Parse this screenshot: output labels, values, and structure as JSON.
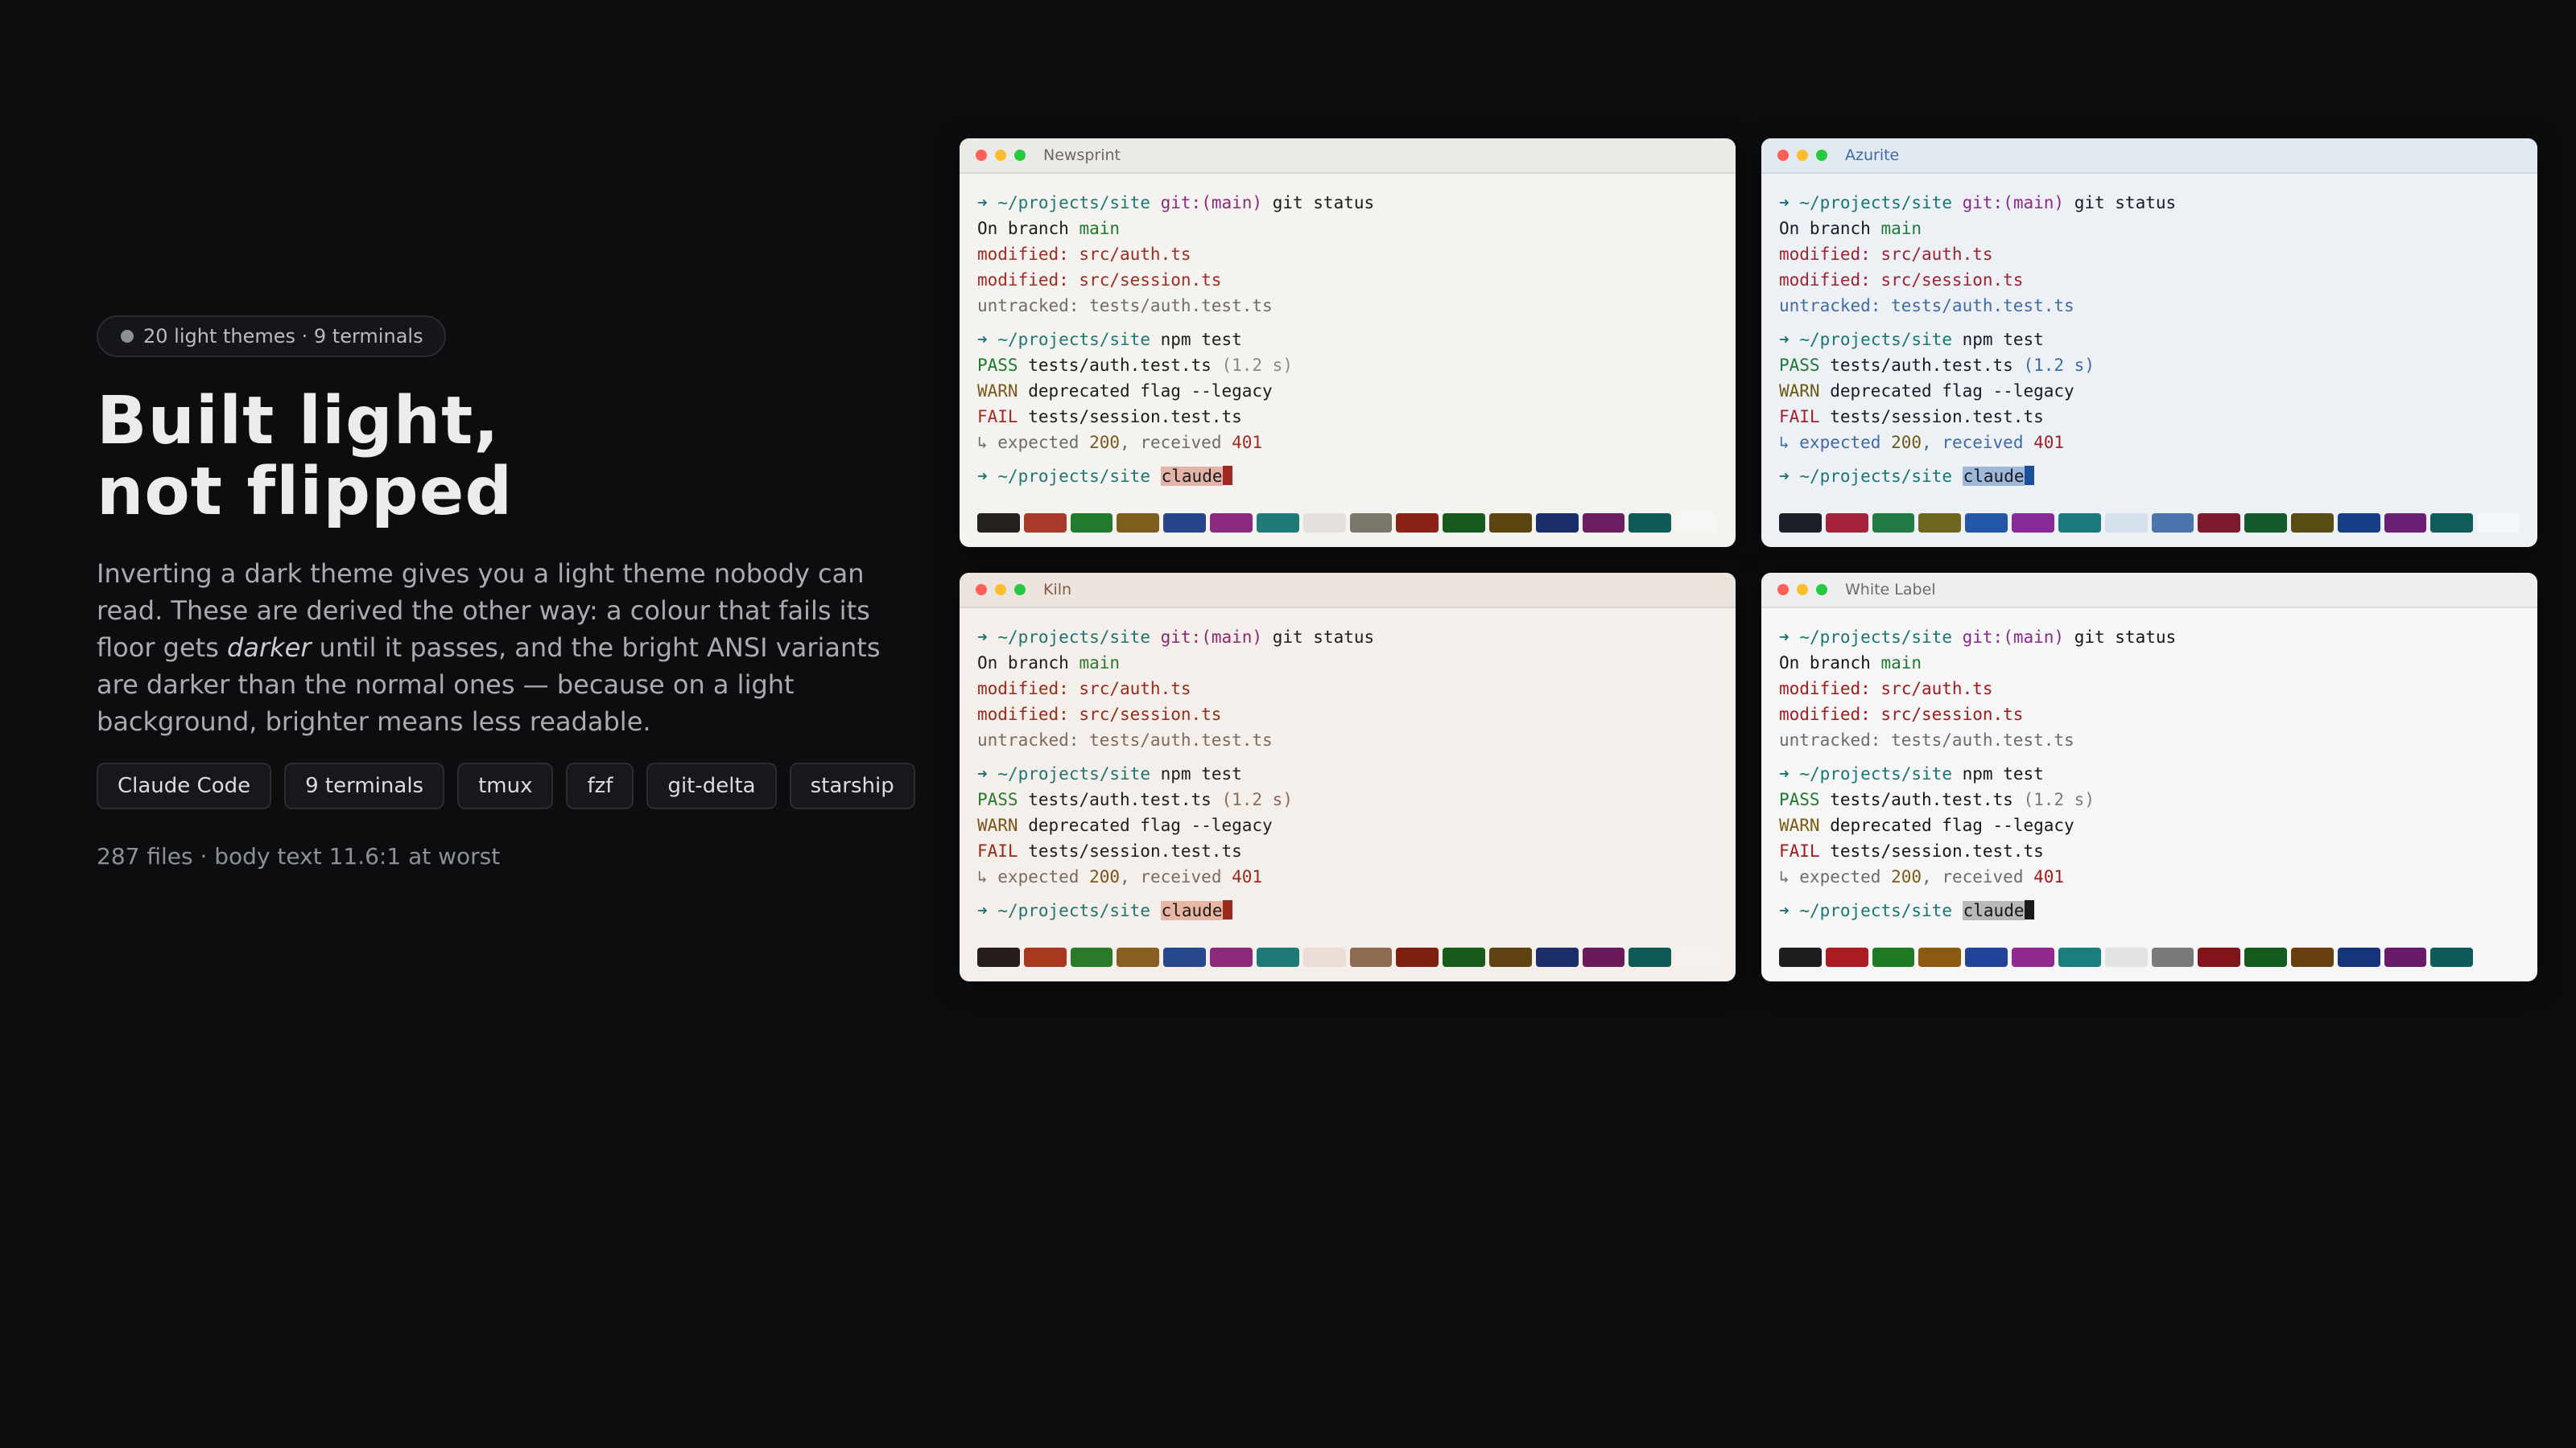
{
  "hero": {
    "badge": "20 light themes · 9 terminals",
    "title_line1": "Built light,",
    "title_line2": "not flipped",
    "desc_before": "Inverting a dark theme gives you a light theme nobody can read. These are derived the other way: a colour that fails its floor gets ",
    "desc_em": "darker",
    "desc_after": " until it passes, and the bright ANSI variants are darker than the normal ones — because on a light background, brighter means less readable.",
    "chips": [
      "Claude Code",
      "9 terminals",
      "tmux",
      "fzf",
      "git-delta",
      "starship"
    ],
    "meta": "287 files · body text 11.6:1 at worst"
  },
  "terminal_text": {
    "prompt_arrow": "➜",
    "path": "~/projects/site",
    "git_label": "git:(main)",
    "cmd_git": "git status",
    "on_branch": "On branch",
    "branch": "main",
    "mod1": "modified: src/auth.ts",
    "mod2": "modified: src/session.ts",
    "untracked": "untracked: tests/auth.test.ts",
    "cmd_npm": "npm test",
    "pass": "PASS",
    "pass_file": "tests/auth.test.ts",
    "duration": "(1.2 s)",
    "warn": "WARN",
    "warn_msg": "deprecated flag --legacy",
    "fail": "FAIL",
    "fail_file": "tests/session.test.ts",
    "exp_prefix": "↳ expected",
    "exp_val": "200",
    "exp_mid": ", received",
    "rec_val": "401",
    "selected": "claude"
  },
  "themes": [
    {
      "name": "Newsprint",
      "bg": "#f4f3f0",
      "title_bg": "#eceae6",
      "fg": "#1d1b19",
      "title_fg": "#6b6864",
      "arrow": "#1e7775",
      "path": "#1e7775",
      "git": "#8a2a7a",
      "green": "#1f7a2c",
      "red": "#a12b22",
      "dim": "#6f6c68",
      "yellow": "#7a5a1c",
      "dur": "#8a8784",
      "num": "#7a5a1c",
      "numred": "#a12b22",
      "sel_bg": "#e2b3a8",
      "cursor": "#a12b22",
      "palette": [
        "#24201e",
        "#a83a2a",
        "#237a2e",
        "#7d5e1f",
        "#26458a",
        "#8b2a7f",
        "#1f7b7a",
        "#e4e1dc",
        "#7a7669",
        "#8a2218",
        "#175a1f",
        "#5d4512",
        "#1a2f6a",
        "#6a1d60",
        "#0f5b58",
        "#f7f6f4"
      ]
    },
    {
      "name": "Azurite",
      "bg": "#edf1f6",
      "title_bg": "#e3e9f1",
      "fg": "#161b24",
      "title_fg": "#3d6aa8",
      "arrow": "#187575",
      "path": "#187575",
      "git": "#8a2a8a",
      "green": "#1f7a3a",
      "red": "#a0222e",
      "dim": "#3d6aa8",
      "yellow": "#6b5a16",
      "dur": "#3d6aa8",
      "num": "#6b5a16",
      "numred": "#a0222e",
      "sel_bg": "#9fb7d9",
      "cursor": "#1f4e9a",
      "palette": [
        "#1b1f26",
        "#a4233a",
        "#1f7a45",
        "#6f6620",
        "#2456a8",
        "#8a2a98",
        "#1b7a80",
        "#d7e1ee",
        "#4d74ad",
        "#7d1a2c",
        "#145a2a",
        "#574c12",
        "#173f88",
        "#6a1e74",
        "#0f5c5a",
        "#f3f6fa"
      ]
    },
    {
      "name": "Kiln",
      "bg": "#f4efeb",
      "title_bg": "#ebe4df",
      "fg": "#231b16",
      "title_fg": "#8a5a40",
      "arrow": "#1f7470",
      "path": "#1f7470",
      "git": "#8a2a6e",
      "green": "#2a7a2c",
      "red": "#9a2a1a",
      "dim": "#7a6a60",
      "yellow": "#7a5418",
      "dur": "#8a6a58",
      "num": "#7a5418",
      "numred": "#9a2a1a",
      "sel_bg": "#e7b6a4",
      "cursor": "#9a2a1a",
      "palette": [
        "#261e1a",
        "#a8391e",
        "#2a7a2c",
        "#876020",
        "#27488c",
        "#8c2a7a",
        "#1e7a76",
        "#ecdcd6",
        "#8e6a52",
        "#7e2010",
        "#175a1a",
        "#5e4212",
        "#1b2f6a",
        "#6a1a5c",
        "#0f5a54",
        "#f6f1ee"
      ]
    },
    {
      "name": "White Label",
      "bg": "#f6f6f6",
      "title_bg": "#eeeeee",
      "fg": "#161616",
      "title_fg": "#6b6b6b",
      "arrow": "#187575",
      "path": "#187575",
      "git": "#8a2a8a",
      "green": "#1f7a2c",
      "red": "#a01c1c",
      "dim": "#6b6b6b",
      "yellow": "#7a5a10",
      "dur": "#7b7b7b",
      "num": "#7a5a10",
      "numred": "#a01c1c",
      "sel_bg": "#b8b8b8",
      "cursor": "#1a1a1a",
      "palette": [
        "#1e1e1e",
        "#a81c22",
        "#1f7a24",
        "#8a5a12",
        "#21449a",
        "#902a90",
        "#1a7e7e",
        "#e3e3e3",
        "#7a7a7a",
        "#80141a",
        "#145a1a",
        "#684010",
        "#16347a",
        "#6a1a6a",
        "#0e5c5a",
        "#f8f8f8"
      ]
    }
  ]
}
